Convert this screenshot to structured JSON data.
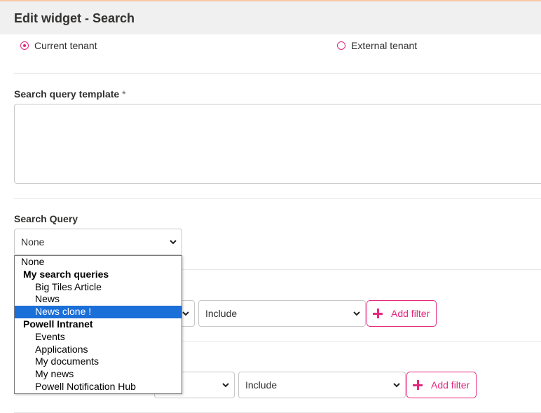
{
  "header": {
    "title": "Edit widget - Search"
  },
  "tenant": {
    "current_label": "Current tenant",
    "external_label": "External tenant",
    "selected": "current"
  },
  "query_template": {
    "label": "Search query template",
    "required_mark": "*",
    "value": ""
  },
  "search_query": {
    "label": "Search Query",
    "selected_value": "None",
    "options": [
      {
        "label": "None",
        "kind": "option"
      },
      {
        "label": "My search queries",
        "kind": "group"
      },
      {
        "label": "Big Tiles Article",
        "kind": "child"
      },
      {
        "label": "News",
        "kind": "child"
      },
      {
        "label": "News clone !",
        "kind": "child",
        "highlighted": true
      },
      {
        "label": "Powell Intranet",
        "kind": "group"
      },
      {
        "label": "Events",
        "kind": "child"
      },
      {
        "label": "Applications",
        "kind": "child"
      },
      {
        "label": "My documents",
        "kind": "child"
      },
      {
        "label": "My news",
        "kind": "child"
      },
      {
        "label": "Powell Notification Hub",
        "kind": "child"
      }
    ]
  },
  "filter_rows": [
    {
      "include_value": "Include",
      "add_filter_label": "Add filter"
    },
    {
      "include_value": "Include",
      "add_filter_label": "Add filter"
    }
  ],
  "colors": {
    "accent": "#e5277e",
    "highlight": "#1a6fd8",
    "header_bg": "#f0f0f0"
  },
  "icons": {
    "dropdown": "chevron-down-icon",
    "add": "plus-icon"
  }
}
